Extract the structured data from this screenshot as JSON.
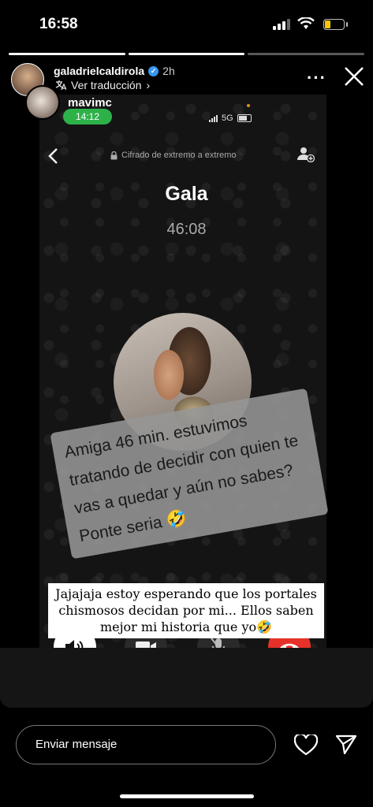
{
  "status_bar": {
    "time": "16:58"
  },
  "story": {
    "username": "galadrielcaldirola",
    "age": "2h",
    "translate_label": "Ver traducción",
    "mention": "mavimc",
    "pill_time": "14:12",
    "progress": {
      "segments": 3,
      "current": 2
    }
  },
  "call_screen": {
    "network": "5G",
    "encryption": "Cifrado de extremo a extremo",
    "contact_name": "Gala",
    "duration": "46:08"
  },
  "sticker_text": [
    "Amiga 46 min. estuvimos",
    "tratando de decidir con quien te",
    "vas a quedar y aún no  sabes?",
    "Ponte seria 🤣"
  ],
  "caption": "Jajajaja estoy esperando que los portales chismosos decidan por mi... Ellos saben mejor mi historia que yo🤣",
  "reply": {
    "placeholder": "Enviar mensaje"
  },
  "icons": {
    "verified": "verified-badge-icon",
    "more": "more-icon",
    "close": "close-icon",
    "heart": "heart-icon",
    "send": "send-icon"
  },
  "colors": {
    "pill_green": "#2db24a",
    "end_call_red": "#e5312a",
    "verified_blue": "#3897f0"
  }
}
